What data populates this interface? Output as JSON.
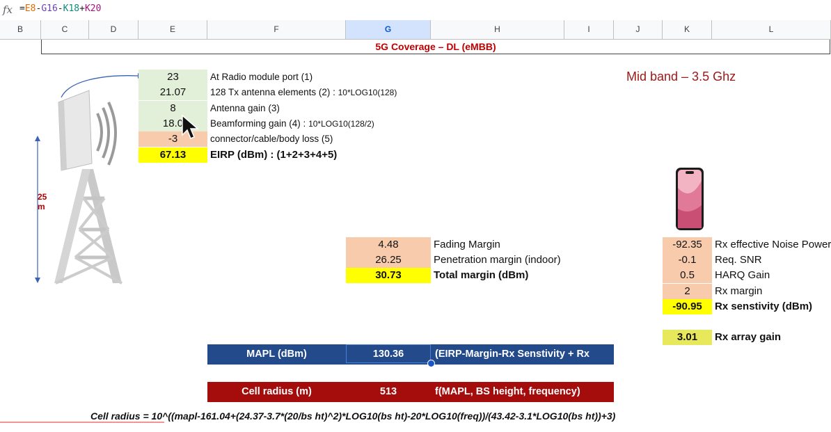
{
  "formula_bar": {
    "fx_label": "fx",
    "tokens": [
      {
        "text": "=",
        "color": "#202124"
      },
      {
        "text": "E8",
        "color": "#e06c00"
      },
      {
        "text": "-",
        "color": "#202124"
      },
      {
        "text": "G16",
        "color": "#6b3fb5"
      },
      {
        "text": "-",
        "color": "#202124"
      },
      {
        "text": "K18",
        "color": "#0a8a7a"
      },
      {
        "text": "+",
        "color": "#202124"
      },
      {
        "text": "K20",
        "color": "#a0147a"
      }
    ]
  },
  "columns": [
    "B",
    "C",
    "D",
    "E",
    "F",
    "G",
    "H",
    "I",
    "J",
    "K",
    "L"
  ],
  "selected_column": "G",
  "title": "5G Coverage – DL (eMBB)",
  "band_label": "Mid band – 3.5 Ghz",
  "height_label": {
    "value": "25",
    "unit": "m"
  },
  "eirp": {
    "rows": [
      {
        "value": "23",
        "label": "At Radio module port (1)",
        "extra": ""
      },
      {
        "value": "21.07",
        "label": "128 Tx antenna elements (2) : ",
        "extra": "10*LOG10(128)"
      },
      {
        "value": "8",
        "label": "Antenna gain (3)",
        "extra": ""
      },
      {
        "value": "18.0",
        "label": "Beamforming gain (4) : ",
        "extra": "10*LOG10(128/2)"
      },
      {
        "value": "-3",
        "label": "connector/cable/body loss (5)",
        "extra": ""
      }
    ],
    "total_value": "67.13",
    "total_label": "EIRP (dBm)  :  (1+2+3+4+5)"
  },
  "margins": {
    "rows": [
      {
        "value": "4.48",
        "label": "Fading Margin"
      },
      {
        "value": "26.25",
        "label": "Penetration margin (indoor)"
      }
    ],
    "total_value": "30.73",
    "total_label": "Total margin (dBm)"
  },
  "rx": {
    "rows": [
      {
        "value": "-92.35",
        "label": "Rx effective Noise Power"
      },
      {
        "value": "-0.1",
        "label": "Req. SNR"
      },
      {
        "value": "0.5",
        "label": "HARQ Gain"
      },
      {
        "value": "2",
        "label": "Rx margin"
      }
    ],
    "total_value": "-90.95",
    "total_label": "Rx senstivity (dBm)",
    "array_gain_value": "3.01",
    "array_gain_label": "Rx array gain"
  },
  "mapl": {
    "label": "MAPL (dBm)",
    "value": "130.36",
    "description": "(EIRP-Margin-Rx Senstivity + Rx gain)"
  },
  "cell_radius": {
    "label": "Cell radius (m)",
    "value": "513",
    "description": "f(MAPL, BS height, frequency)"
  },
  "radius_formula": "Cell radius = 10^((mapl-161.04+(24.37-3.7*(20/bs ht)^2)*LOG10(bs ht)-20*LOG10(freq))/(43.42-3.1*LOG10(bs ht))+3)",
  "colors": {
    "title_red": "#c00000",
    "green_cell": "#e2efd9",
    "peach_cell": "#f8cbad",
    "yellow_cell": "#ffff00",
    "mapl_blue": "#234b8c",
    "radius_red": "#a50d0d"
  }
}
